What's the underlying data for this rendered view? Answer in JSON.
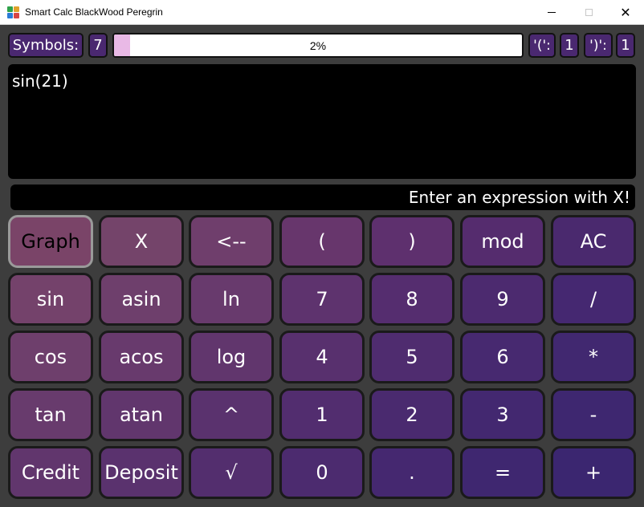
{
  "window": {
    "title": "Smart Calc BlackWood Peregrin",
    "close_glyph": "✕"
  },
  "topbar": {
    "symbols_label": "Symbols:",
    "symbols_count": "7",
    "progress_text": "2%",
    "progress_fraction": 0.02,
    "open_paren_label": "'(':",
    "open_paren_count": "1",
    "close_paren_label": "')':",
    "close_paren_count": "1"
  },
  "editor": {
    "expression": "sin(21)"
  },
  "status": {
    "message": "Enter an expression with X!"
  },
  "keys": [
    {
      "label": "Graph",
      "name": "graph-button",
      "color": "#7a4468",
      "active": true
    },
    {
      "label": "X",
      "name": "x-variable-button",
      "color": "#74446a"
    },
    {
      "label": "<--",
      "name": "backspace-button",
      "color": "#6f3e6c"
    },
    {
      "label": "(",
      "name": "open-paren-button",
      "color": "#67366c"
    },
    {
      "label": ")",
      "name": "close-paren-button",
      "color": "#5e306e"
    },
    {
      "label": "mod",
      "name": "mod-button",
      "color": "#552c6e"
    },
    {
      "label": "AC",
      "name": "clear-all-button",
      "color": "#4a296e"
    },
    {
      "label": "sin",
      "name": "sin-button",
      "color": "#74426b"
    },
    {
      "label": "asin",
      "name": "asin-button",
      "color": "#6e3f6c"
    },
    {
      "label": "ln",
      "name": "ln-button",
      "color": "#683a6d"
    },
    {
      "label": "7",
      "name": "digit-7-button",
      "color": "#5e336e"
    },
    {
      "label": "8",
      "name": "digit-8-button",
      "color": "#552d6f"
    },
    {
      "label": "9",
      "name": "digit-9-button",
      "color": "#4c2a6f"
    },
    {
      "label": "/",
      "name": "divide-button",
      "color": "#452871"
    },
    {
      "label": "cos",
      "name": "cos-button",
      "color": "#6e3f6c"
    },
    {
      "label": "acos",
      "name": "acos-button",
      "color": "#683a6d"
    },
    {
      "label": "log",
      "name": "log-button",
      "color": "#61366d"
    },
    {
      "label": "4",
      "name": "digit-4-button",
      "color": "#58306e"
    },
    {
      "label": "5",
      "name": "digit-5-button",
      "color": "#4f2c6f"
    },
    {
      "label": "6",
      "name": "digit-6-button",
      "color": "#472970"
    },
    {
      "label": "*",
      "name": "multiply-button",
      "color": "#412870"
    },
    {
      "label": "tan",
      "name": "tan-button",
      "color": "#683b6d"
    },
    {
      "label": "atan",
      "name": "atan-button",
      "color": "#61366d"
    },
    {
      "label": "^",
      "name": "power-button",
      "color": "#5a326e"
    },
    {
      "label": "1",
      "name": "digit-1-button",
      "color": "#522d6f"
    },
    {
      "label": "2",
      "name": "digit-2-button",
      "color": "#4a2a6f"
    },
    {
      "label": "3",
      "name": "digit-3-button",
      "color": "#432870"
    },
    {
      "label": "-",
      "name": "subtract-button",
      "color": "#3e2770"
    },
    {
      "label": "Credit",
      "name": "credit-button",
      "color": "#61366d"
    },
    {
      "label": "Deposit",
      "name": "deposit-button",
      "color": "#5a326e"
    },
    {
      "label": "√",
      "name": "sqrt-button",
      "color": "#532e6e"
    },
    {
      "label": "0",
      "name": "digit-0-button",
      "color": "#4c2b6f"
    },
    {
      "label": ".",
      "name": "decimal-point-button",
      "color": "#452870"
    },
    {
      "label": "=",
      "name": "equals-button",
      "color": "#3f2770"
    },
    {
      "label": "+",
      "name": "add-button",
      "color": "#3b2670"
    }
  ]
}
